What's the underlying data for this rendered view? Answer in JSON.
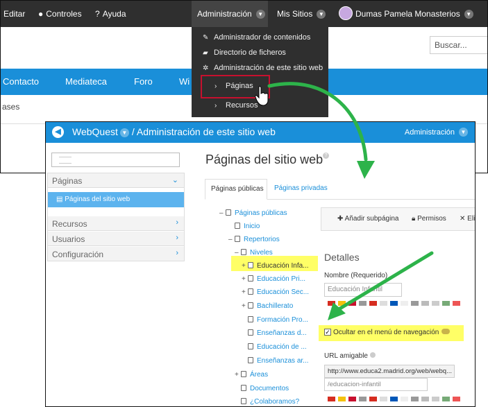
{
  "topbar": {
    "editar": "Editar",
    "controles": "Controles",
    "ayuda": "Ayuda",
    "administracion": "Administración",
    "mis_sitios": "Mis Sitios",
    "user_name": "Dumas Pamela Monasterios"
  },
  "search": {
    "placeholder": "Buscar..."
  },
  "dropdown": {
    "items": [
      {
        "label": "Administrador de contenidos",
        "icon": "pencil-square-icon"
      },
      {
        "label": "Directorio de ficheros",
        "icon": "folder-open-icon"
      },
      {
        "label": "Administración de este sitio web",
        "icon": "gear-icon"
      },
      {
        "label": "Páginas",
        "icon": "chevron-right-icon"
      },
      {
        "label": "Recursos",
        "icon": "chevron-right-icon"
      }
    ]
  },
  "site_nav": {
    "items": [
      "Contacto",
      "Mediateca",
      "Foro",
      "Wi"
    ],
    "breadcrumb": "ases"
  },
  "panel": {
    "title_site": "WebQuest",
    "title_rest": "/ Administración de este sitio web",
    "admin_label": "Administración"
  },
  "sidebar": {
    "sections": [
      {
        "label": "Páginas",
        "chevron": "chevron-down-icon"
      },
      {
        "label": "Recursos",
        "chevron": "chevron-right-icon"
      },
      {
        "label": "Usuarios",
        "chevron": "chevron-right-icon"
      },
      {
        "label": "Configuración",
        "chevron": "chevron-right-icon"
      }
    ],
    "active_item": "Páginas del sitio web"
  },
  "main": {
    "title": "Páginas del sitio web",
    "tabs": [
      {
        "label": "Páginas públicas",
        "active": true
      },
      {
        "label": "Páginas privadas",
        "active": false
      }
    ],
    "tree": [
      {
        "toggle": "–",
        "label": "Páginas públicas"
      },
      {
        "toggle": "",
        "label": "Inicio"
      },
      {
        "toggle": "–",
        "label": "Repertorios"
      },
      {
        "toggle": "–",
        "label": "Niveles"
      },
      {
        "toggle": "+",
        "label": "Educación Infa..."
      },
      {
        "toggle": "+",
        "label": "Educación Pri..."
      },
      {
        "toggle": "+",
        "label": "Educación Sec..."
      },
      {
        "toggle": "+",
        "label": "Bachillerato"
      },
      {
        "toggle": "",
        "label": "Formación Pro..."
      },
      {
        "toggle": "",
        "label": "Enseñanzas d..."
      },
      {
        "toggle": "",
        "label": "Educación de ..."
      },
      {
        "toggle": "",
        "label": "Enseñanzas ar..."
      },
      {
        "toggle": "+",
        "label": "Áreas"
      },
      {
        "toggle": "",
        "label": "Documentos"
      },
      {
        "toggle": "",
        "label": "¿Colaboramos?"
      }
    ],
    "toolbar": {
      "add_subpage": "Añadir subpágina",
      "permissions": "Permisos",
      "delete": "Eli"
    },
    "details": {
      "heading": "Detalles",
      "name_label": "Nombre (Requerido)",
      "name_value": "Educación Infantil",
      "hide_label": "Ocultar en el menú de navegación",
      "hide_checked": true,
      "url_label": "URL amigable",
      "url_prefix": "http://www.educa2.madrid.org/web/webq...",
      "url_value": "/educacion-infantil"
    }
  },
  "colors": {
    "topbar": "#2f2f2f",
    "accent_blue": "#1a8fd9",
    "highlight_yellow": "#ffff66",
    "arrow_green": "#2db34a",
    "callout_red": "#c8102e"
  }
}
